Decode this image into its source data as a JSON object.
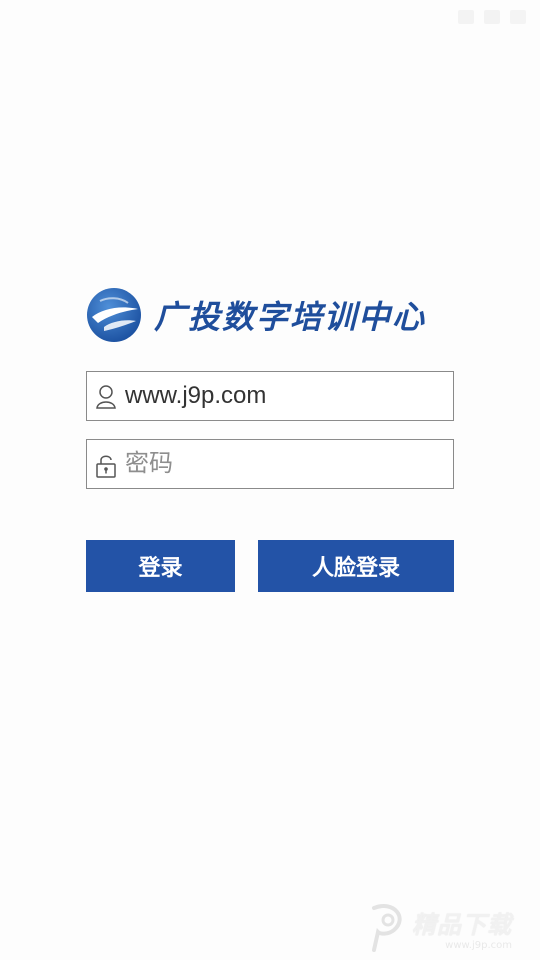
{
  "brand": {
    "name": "广投数字培训中心",
    "logo_icon": "globe-plane-logo-icon",
    "primary_color": "#1f4e9c"
  },
  "login_form": {
    "username": {
      "value": "www.j9p.com",
      "icon": "user-icon"
    },
    "password": {
      "placeholder": "密码",
      "icon": "lock-icon"
    }
  },
  "buttons": {
    "login_label": "登录",
    "face_login_label": "人脸登录",
    "color": "#2353a7"
  },
  "watermark": {
    "title": "精品下载",
    "url": "www.j9p.com"
  }
}
